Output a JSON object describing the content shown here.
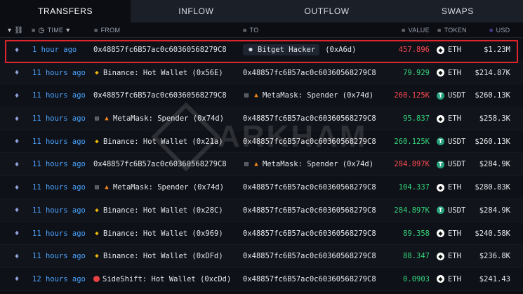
{
  "tabs": [
    {
      "label": "TRANSFERS",
      "active": true
    },
    {
      "label": "INFLOW",
      "active": false
    },
    {
      "label": "OUTFLOW",
      "active": false
    },
    {
      "label": "SWAPS",
      "active": false
    }
  ],
  "header": {
    "time": "TIME",
    "from": "FROM",
    "to": "TO",
    "value": "VALUE",
    "token": "TOKEN",
    "usd": "USD"
  },
  "watermark": "ARKHAM",
  "rows": [
    {
      "time": "1 hour ago",
      "from": {
        "label": "0x48857fc6B57ac0c60360568279C8",
        "icon": "none"
      },
      "to": {
        "label": "Bitget Hacker",
        "suffix": "(0xA6d)",
        "icon": "person"
      },
      "value": "457.896",
      "direction": "out",
      "token": "ETH",
      "usd": "$1.23M"
    },
    {
      "time": "11 hours ago",
      "from": {
        "label": "Binance: Hot Wallet (0x56E)",
        "icon": "binance"
      },
      "to": {
        "label": "0x48857fc6B57ac0c60360568279C8",
        "icon": "none"
      },
      "value": "79.929",
      "direction": "in",
      "token": "ETH",
      "usd": "$214.87K"
    },
    {
      "time": "11 hours ago",
      "from": {
        "label": "0x48857fc6B57ac0c60360568279C8",
        "icon": "none"
      },
      "to": {
        "label": "MetaMask: Spender (0x74d)",
        "icon": "metamask"
      },
      "value": "260.125K",
      "direction": "out",
      "token": "USDT",
      "usd": "$260.13K"
    },
    {
      "time": "11 hours ago",
      "from": {
        "label": "MetaMask: Spender (0x74d)",
        "icon": "metamask"
      },
      "to": {
        "label": "0x48857fc6B57ac0c60360568279C8",
        "icon": "none"
      },
      "value": "95.837",
      "direction": "in",
      "token": "ETH",
      "usd": "$258.3K"
    },
    {
      "time": "11 hours ago",
      "from": {
        "label": "Binance: Hot Wallet (0x21a)",
        "icon": "binance"
      },
      "to": {
        "label": "0x48857fc6B57ac0c60360568279C8",
        "icon": "none"
      },
      "value": "260.125K",
      "direction": "in",
      "token": "USDT",
      "usd": "$260.13K"
    },
    {
      "time": "11 hours ago",
      "from": {
        "label": "0x48857fc6B57ac0c60360568279C8",
        "icon": "none"
      },
      "to": {
        "label": "MetaMask: Spender (0x74d)",
        "icon": "metamask"
      },
      "value": "284.897K",
      "direction": "out",
      "token": "USDT",
      "usd": "$284.9K"
    },
    {
      "time": "11 hours ago",
      "from": {
        "label": "MetaMask: Spender (0x74d)",
        "icon": "metamask"
      },
      "to": {
        "label": "0x48857fc6B57ac0c60360568279C8",
        "icon": "none"
      },
      "value": "104.337",
      "direction": "in",
      "token": "ETH",
      "usd": "$280.83K"
    },
    {
      "time": "11 hours ago",
      "from": {
        "label": "Binance: Hot Wallet (0x28C)",
        "icon": "binance"
      },
      "to": {
        "label": "0x48857fc6B57ac0c60360568279C8",
        "icon": "none"
      },
      "value": "284.897K",
      "direction": "in",
      "token": "USDT",
      "usd": "$284.9K"
    },
    {
      "time": "11 hours ago",
      "from": {
        "label": "Binance: Hot Wallet (0x969)",
        "icon": "binance"
      },
      "to": {
        "label": "0x48857fc6B57ac0c60360568279C8",
        "icon": "none"
      },
      "value": "89.358",
      "direction": "in",
      "token": "ETH",
      "usd": "$240.58K"
    },
    {
      "time": "11 hours ago",
      "from": {
        "label": "Binance: Hot Wallet (0xDFd)",
        "icon": "binance"
      },
      "to": {
        "label": "0x48857fc6B57ac0c60360568279C8",
        "icon": "none"
      },
      "value": "88.347",
      "direction": "in",
      "token": "ETH",
      "usd": "$236.8K"
    },
    {
      "time": "12 hours ago",
      "from": {
        "label": "SideShift: Hot Wallet (0xcDd)",
        "icon": "sideshift"
      },
      "to": {
        "label": "0x48857fc6B57ac0c60360568279C8",
        "icon": "none"
      },
      "value": "0.0903",
      "direction": "in",
      "token": "ETH",
      "usd": "$241.43"
    }
  ],
  "colors": {
    "positive": "#34d47e",
    "negative": "#ff4a52",
    "time_link": "#4aa3ff",
    "highlight_box": "#e0242b"
  }
}
